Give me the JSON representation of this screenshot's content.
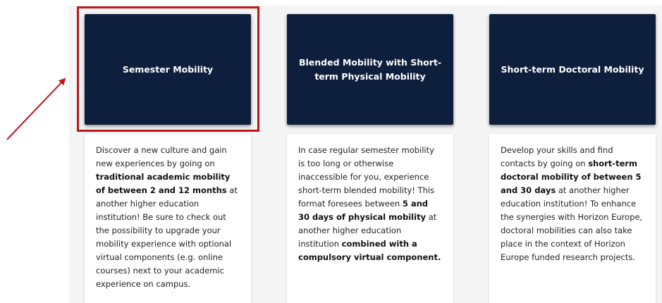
{
  "cards": [
    {
      "title": "Semester Mobility",
      "desc": [
        {
          "t": "Discover a new culture and gain new experiences by going on ",
          "b": false
        },
        {
          "t": "traditional academic mobility of between 2 and 12 months",
          "b": true
        },
        {
          "t": " at another higher education institution! Be sure to check out the possibility to upgrade your mobility experience with optional virtual components (e.g. online courses) next to your academic experience on campus.",
          "b": false
        }
      ]
    },
    {
      "title": "Blended Mobility with Short-term Physical Mobility",
      "desc": [
        {
          "t": "In case regular semester mobility is too long or otherwise inaccessible for you, experience short-term blended mobility! This format foresees between ",
          "b": false
        },
        {
          "t": "5 and 30 days of physical mobility",
          "b": true
        },
        {
          "t": " at another higher education institution ",
          "b": false
        },
        {
          "t": "combined with a compulsory virtual component.",
          "b": true
        }
      ]
    },
    {
      "title": "Short-term Doctoral Mobility",
      "desc": [
        {
          "t": "Develop your skills and find contacts by going on ",
          "b": false
        },
        {
          "t": "short-term doctoral mobility of between 5 and 30 days",
          "b": true
        },
        {
          "t": " at another higher education institution! To enhance the synergies with Horizon Europe, doctoral mobilities can also take place in the context of Horizon Europe funded research projects.",
          "b": false
        }
      ]
    }
  ],
  "annotation": {
    "highlight_color": "#c0161b",
    "arrow_color": "#c0161b",
    "tile_color": "#0e1e3d"
  }
}
